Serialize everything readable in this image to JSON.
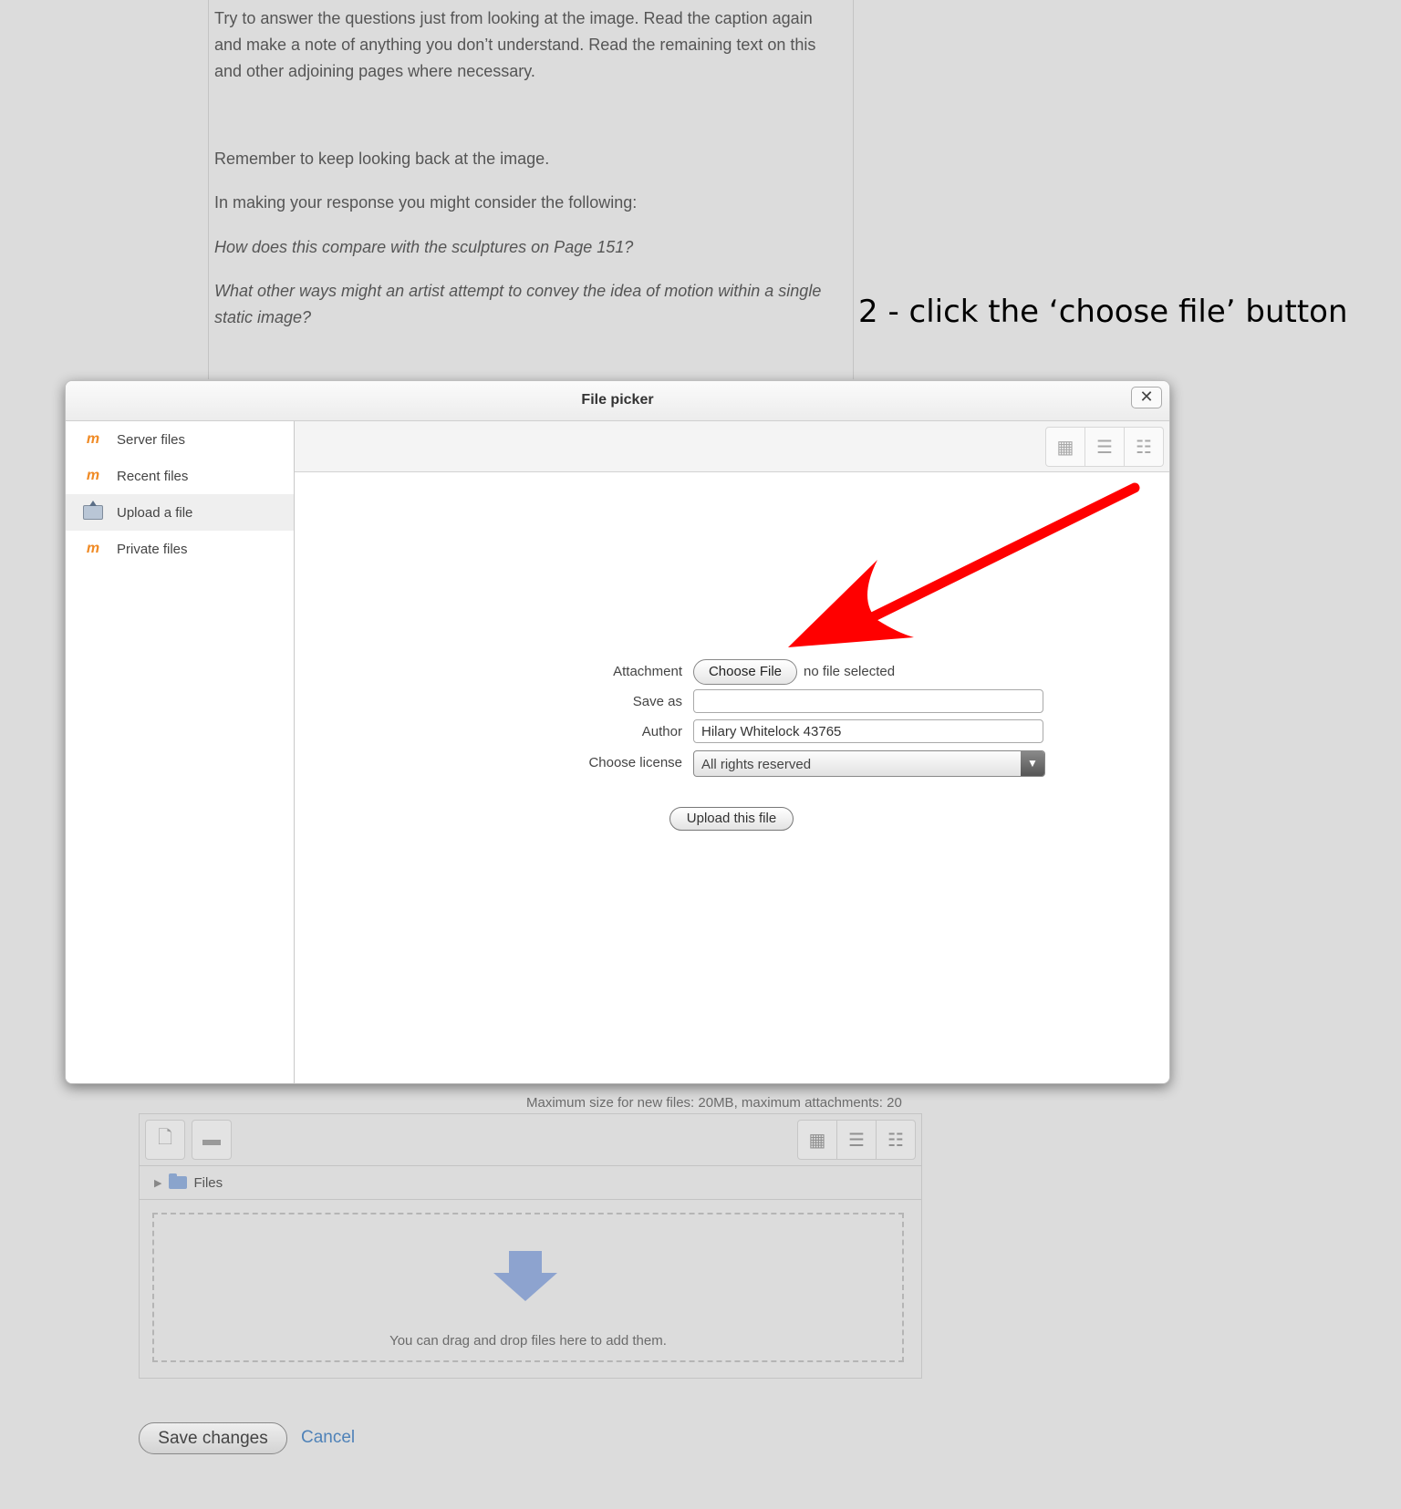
{
  "page": {
    "paragraphs": [
      {
        "text": " Try to answer the questions just from looking at the image. Read the caption again and make a note of anything you don’t understand. Read the remaining text on this and other adjoining pages where necessary.",
        "italic": false
      },
      {
        "text": "Remember to keep looking back at the image.",
        "italic": false
      },
      {
        "text": "In making your response you might consider the following:",
        "italic": false
      },
      {
        "text": "How does this compare with the sculptures on Page 151?",
        "italic": true
      },
      {
        "text": "What other ways might an artist attempt to convey the idea of motion within a single static image?",
        "italic": true
      }
    ],
    "annotation": "2 - click the ‘choose file’ button"
  },
  "file_picker": {
    "title": "File picker",
    "close_symbol": "✕",
    "sidebar": [
      {
        "label": "Server files",
        "icon": "moodle-icon",
        "active": false
      },
      {
        "label": "Recent files",
        "icon": "moodle-icon",
        "active": false
      },
      {
        "label": "Upload a file",
        "icon": "upload-icon",
        "active": true
      },
      {
        "label": "Private files",
        "icon": "moodle-icon",
        "active": false
      }
    ],
    "view_buttons": [
      "icons-view",
      "list-view",
      "tree-view"
    ],
    "form": {
      "attachment_label": "Attachment",
      "choose_file_label": "Choose File",
      "no_file_text": "no file selected",
      "save_as_label": "Save as",
      "save_as_value": "",
      "author_label": "Author",
      "author_value": "Hilary Whitelock 43765",
      "license_label": "Choose license",
      "license_value": "All rights reserved",
      "upload_button": "Upload this file"
    },
    "annotation_arrow_color": "#ff0000"
  },
  "file_manager": {
    "max_size_text": "Maximum size for new files: 20MB, maximum attachments: 20",
    "path_label": "Files",
    "drop_text": "You can drag and drop files here to add them."
  },
  "actions": {
    "save_label": "Save changes",
    "cancel_label": "Cancel"
  },
  "colors": {
    "background": "#dcdcdc",
    "link": "#4f82b8",
    "arrow": "#ff0000",
    "moodle_orange": "#f08a24"
  }
}
